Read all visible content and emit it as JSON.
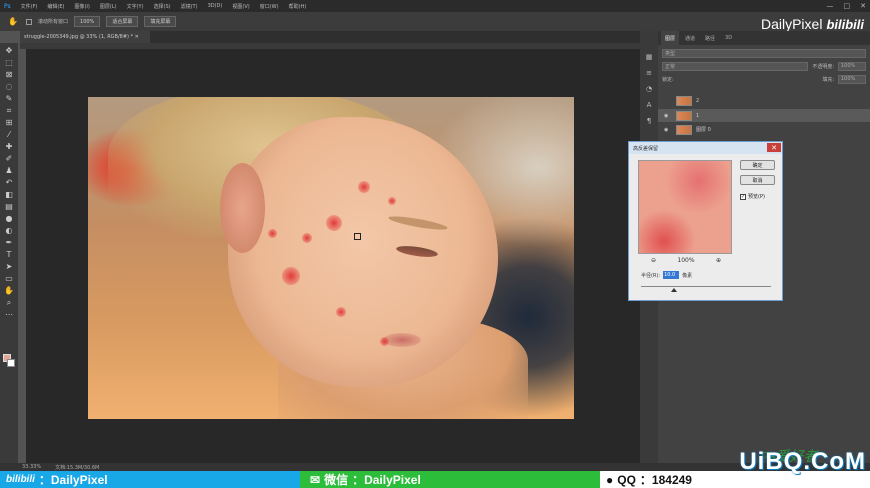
{
  "menubar": {
    "app_logo": "Ps",
    "items": [
      "文件(F)",
      "编辑(E)",
      "图像(I)",
      "图层(L)",
      "文字(Y)",
      "选择(S)",
      "滤镜(T)",
      "3D(D)",
      "视图(V)",
      "窗口(W)",
      "帮助(H)"
    ],
    "window_controls": [
      "—",
      "□",
      "✕"
    ]
  },
  "options": {
    "scroll_all": "滚动所有窗口",
    "zoom": "100%",
    "fit_screen": "适合屏幕",
    "fill_screen": "填充屏幕"
  },
  "watermark_top": {
    "brand": "DailyPixel",
    "site": "bilibili"
  },
  "document": {
    "tab": "struggle-2005349.jpg @ 33% (1, RGB/8#) * ✕"
  },
  "panels": {
    "tabs": [
      "图层",
      "通道",
      "路径",
      "3D"
    ],
    "kind_filter": "类型",
    "blend_mode": "正常",
    "opacity_label": "不透明度:",
    "opacity": "100%",
    "lock_label": "锁定:",
    "fill_label": "填充:",
    "fill": "100%",
    "layers": [
      {
        "name": "2",
        "visible": false
      },
      {
        "name": "1",
        "visible": true
      },
      {
        "name": "图层 0",
        "visible": true
      }
    ]
  },
  "dialog": {
    "title": "高反差保留",
    "ok": "确定",
    "cancel": "取消",
    "preview_label": "预览(P)",
    "preview_checked": "✓",
    "zoom_level": "100%",
    "radius_label": "半径(R):",
    "radius_value": "10.0",
    "radius_unit": "像素",
    "close": "✕",
    "slider_value": 0.25
  },
  "status": {
    "zoom": "33.33%",
    "doc": "文档:15.3M/30.6M"
  },
  "banner": {
    "bilibili": "bilibili",
    "bili_id": "：DailyPixel",
    "wechat_label": "微信",
    "wechat_id": "：DailyPixel",
    "qq_label": "QQ",
    "qq_id": "：184249"
  },
  "watermark_bottom": {
    "site": "UiBQ.CoM",
    "ps": "PS爱好者"
  }
}
